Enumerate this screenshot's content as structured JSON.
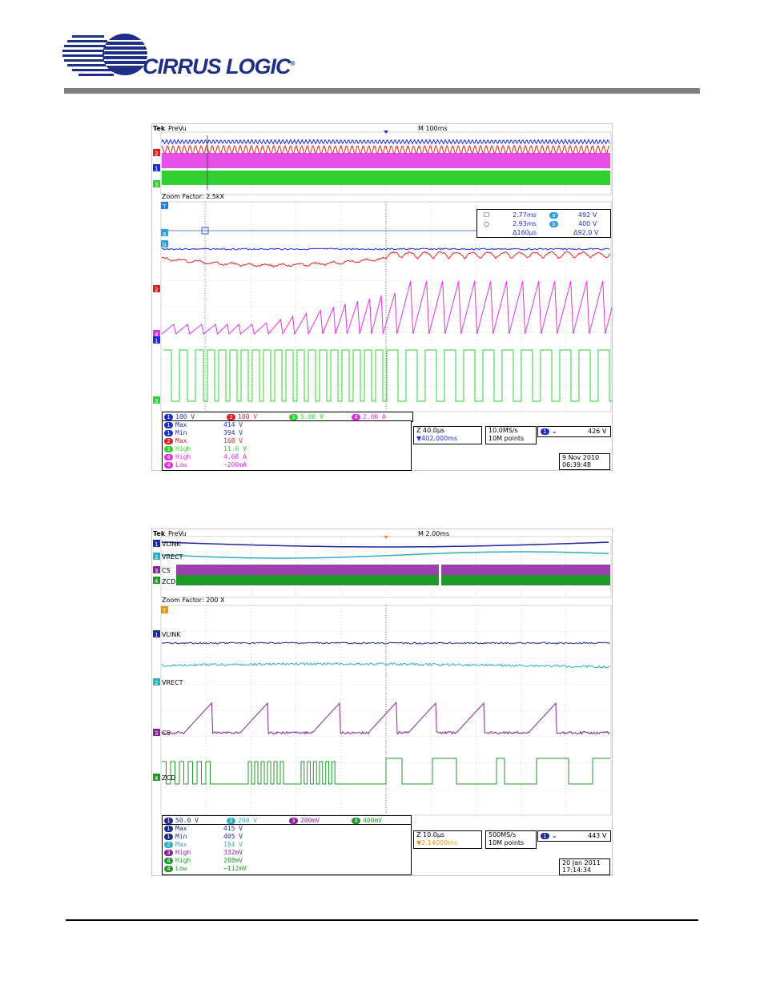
{
  "brand": {
    "name": "CIRRUS LOGIC",
    "mark": "®",
    "color": "#1d2f86"
  },
  "scope1": {
    "top_left": "Tek",
    "mode": "PreVu",
    "timebase": "M 100ms",
    "zoom": "Zoom Factor: 2.5kX",
    "cursor": {
      "t1": "2.77ms",
      "t2": "2.93ms",
      "dt": "Δ160µs",
      "a": "492 V",
      "b": "400 V",
      "dv": "Δ92.0 V"
    },
    "channels": [
      {
        "num": "1",
        "scale": "100 V",
        "color": "#1c2fd0"
      },
      {
        "num": "2",
        "scale": "100 V",
        "color": "#e02020"
      },
      {
        "num": "3",
        "scale": "5.00 V",
        "color": "#2fd02f"
      },
      {
        "num": "4",
        "scale": "2.00 A",
        "color": "#e030e0"
      }
    ],
    "measurements": [
      {
        "ch": "1",
        "label": "Max",
        "value": "414 V",
        "color": "#1c2fd0"
      },
      {
        "ch": "1",
        "label": "Min",
        "value": "394 V",
        "color": "#1c2fd0"
      },
      {
        "ch": "2",
        "label": "Max",
        "value": "168 V",
        "color": "#e02020"
      },
      {
        "ch": "3",
        "label": "High",
        "value": "11.6 V",
        "color": "#2fd02f"
      },
      {
        "ch": "4",
        "label": "High",
        "value": "4.68 A",
        "color": "#e030e0"
      },
      {
        "ch": "4",
        "label": "Low",
        "value": "−200mA",
        "color": "#e030e0"
      }
    ],
    "zoom_time": "Z 40.0µs",
    "trig_pos": "▼402.000ms",
    "sample_rate": "10.0MS/s",
    "points": "10M points",
    "trigger": {
      "ch": "1",
      "slope": "⌄",
      "level": "426 V"
    },
    "date": "9 Nov 2010",
    "time": "06:39:48"
  },
  "scope2": {
    "top_left": "Tek",
    "mode": "PreVu",
    "timebase": "M 2.00ms",
    "zoom": "Zoom Factor: 200 X",
    "trace_labels": [
      "VLINK",
      "VRECT",
      "CS",
      "ZCD"
    ],
    "channels": [
      {
        "num": "1",
        "scale": "50.0 V",
        "color": "#1c2a9a"
      },
      {
        "num": "2",
        "scale": "200 V",
        "color": "#2ab0c0"
      },
      {
        "num": "3",
        "scale": "200mV",
        "color": "#8a1fa0"
      },
      {
        "num": "4",
        "scale": "400mV",
        "color": "#1e9a2a"
      }
    ],
    "measurements": [
      {
        "ch": "1",
        "label": "Max",
        "value": "415 V",
        "color": "#1c2a9a"
      },
      {
        "ch": "1",
        "label": "Min",
        "value": "405 V",
        "color": "#1c2a9a"
      },
      {
        "ch": "2",
        "label": "Max",
        "value": "184 V",
        "color": "#2ab0c0"
      },
      {
        "ch": "3",
        "label": "High",
        "value": "332mV",
        "color": "#8a1fa0"
      },
      {
        "ch": "4",
        "label": "High",
        "value": "288mV",
        "color": "#1e9a2a"
      },
      {
        "ch": "4",
        "label": "Low",
        "value": "−112mV",
        "color": "#1e9a2a"
      }
    ],
    "zoom_time": "Z 10.0µs",
    "trig_pos": "▼2.14000ms",
    "sample_rate": "500MS/s",
    "points": "10M points",
    "trigger": {
      "ch": "1",
      "slope": "⌄",
      "level": "443 V"
    },
    "date": "20 Jan  2011",
    "time": "17:14:34"
  }
}
